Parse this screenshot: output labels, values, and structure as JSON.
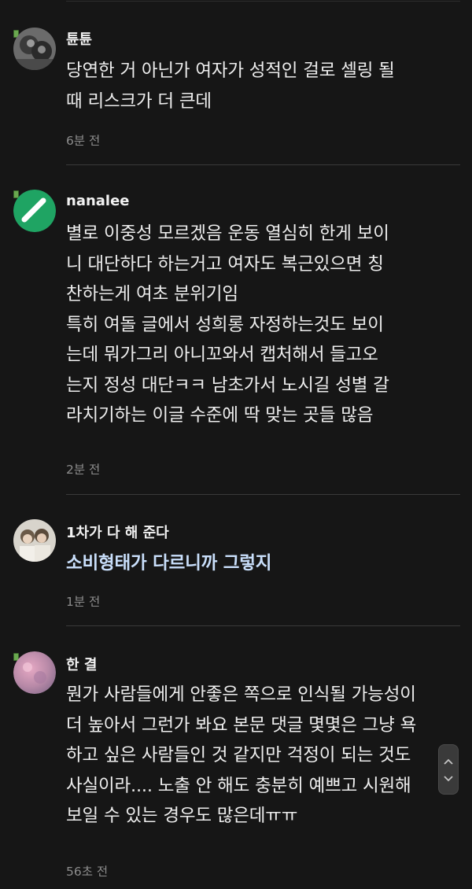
{
  "comments": [
    {
      "author": "튠튠",
      "lines": [
        "당연한 거 아닌가 여자가 성적인 걸로 셀링 될",
        "때 리스크가 더 큰데"
      ],
      "time": "6분 전"
    },
    {
      "author": "nanalee",
      "lines": [
        "별로 이중성 모르겠음 운동 열심히 한게 보이",
        "니 대단하다 하는거고 여자도 복근있으면 칭",
        "찬하는게 여초 분위기임",
        "특히 여돌 글에서 성희롱 자정하는것도 보이",
        "는데 뭐가그리 아니꼬와서 캡처해서 들고오",
        "는지 정성 대단ㅋㅋ 남초가서 노시길 성별 갈",
        "라치기하는 이글 수준에 딱 맞는 곳들 많음"
      ],
      "time": "2분 전"
    },
    {
      "author": "1차가 다 해 준다",
      "lines": [
        "소비형태가 다르니까 그렇지"
      ],
      "time": "1분 전"
    },
    {
      "author": "한 결",
      "lines": [
        "뭔가 사람들에게 안좋은 쪽으로 인식될 가능성이",
        "더 높아서 그런가 봐요 본문 댓글 몇몇은 그냥 욕",
        "하고 싶은 사람들인 것 같지만 걱정이 되는 것도",
        "사실이라.... 노출 안 해도 충분히 예쁘고 시원해",
        "보일 수 있는 경우도 많은데ㅠㅠ"
      ],
      "time": "56초 전"
    }
  ],
  "scroll_handle": {
    "up_icon": "chevron-up-icon",
    "down_icon": "chevron-down-icon"
  }
}
